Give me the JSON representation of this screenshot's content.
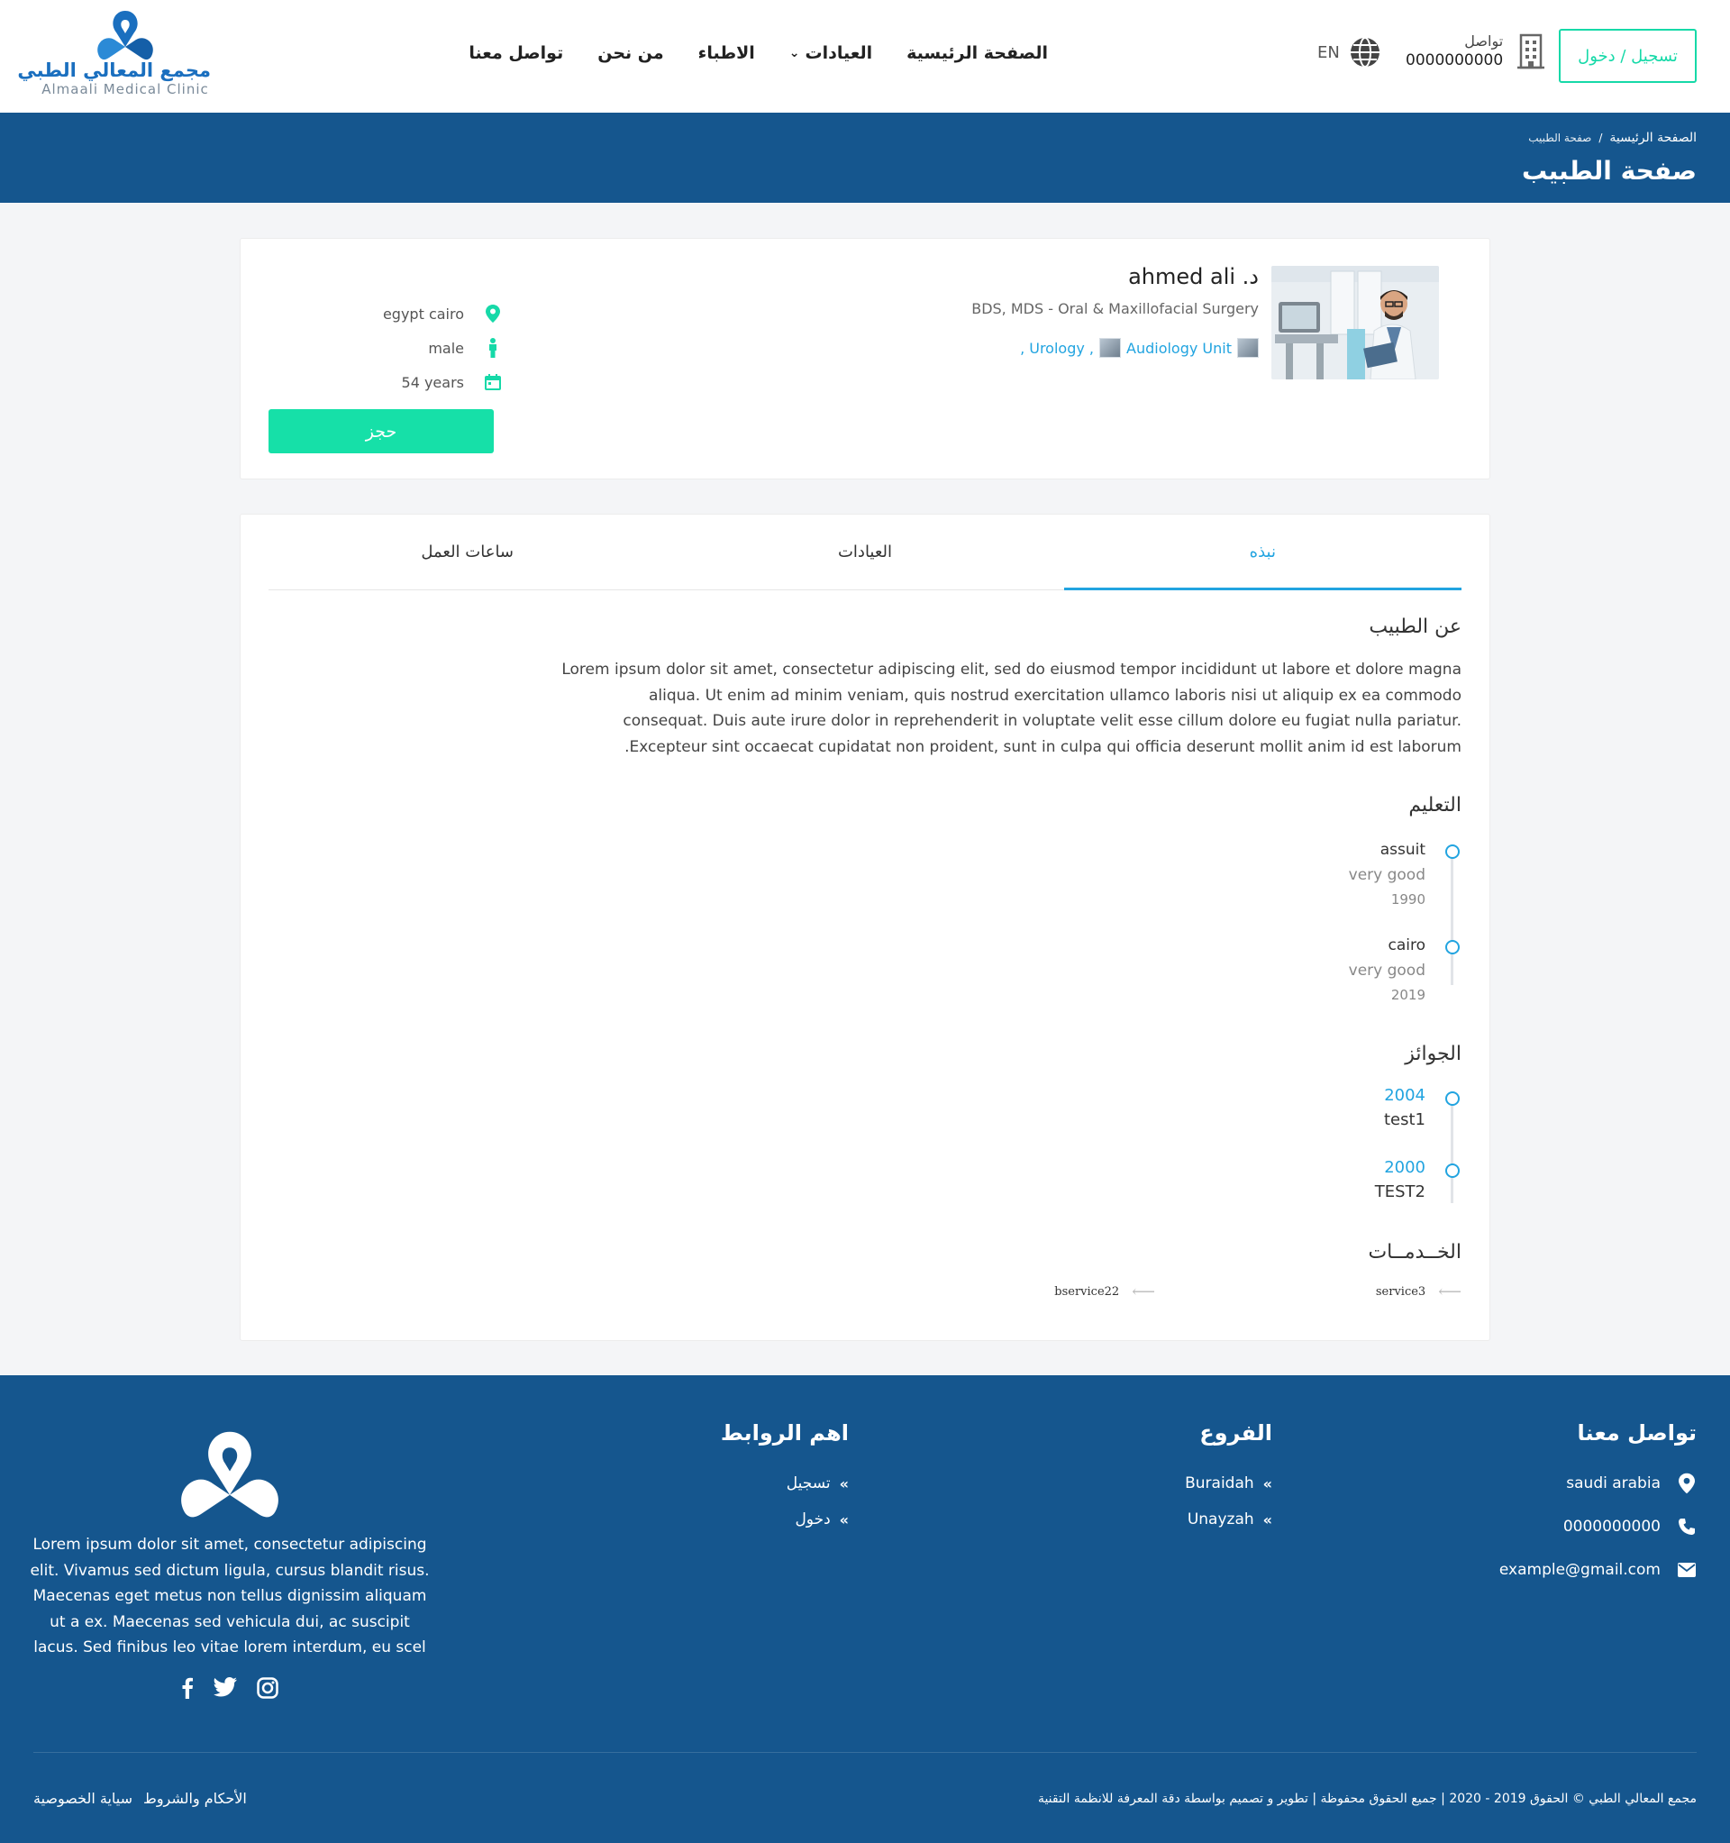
{
  "header": {
    "logo_ar": "مجمع المعالي الطبي",
    "logo_en": "Almaali Medical Clinic",
    "nav": [
      "الصفحة الرئيسية",
      "العيادات",
      "الاطباء",
      "من نحن",
      "تواصل معنا"
    ],
    "lang_code": "EN",
    "contact_label": "تواصل",
    "contact_number": "0000000000",
    "login_label": "تسجيل / دخول"
  },
  "banner": {
    "crumb_home": "الصفحة الرئيسية",
    "crumb_sep": "/",
    "crumb_current": "صفحة الطبيب",
    "title": "صفحة الطبيب"
  },
  "doctor": {
    "name": "د. ahmed ali",
    "degree": "BDS, MDS - Oral & Maxillofacial Surgery",
    "clinic_1": "Audiology Unit",
    "clinic_2": ", Urology ,",
    "location": "egypt cairo",
    "gender": "male",
    "age": "54 years",
    "book_label": "حجز"
  },
  "tabs": [
    "نبذه",
    "العيادات",
    "ساعات العمل"
  ],
  "about": {
    "title": "عن الطبيب",
    "text": "Lorem ipsum dolor sit amet, consectetur adipiscing elit, sed do eiusmod tempor incididunt ut labore et dolore magna aliqua. Ut enim ad minim veniam, quis nostrud exercitation ullamco laboris nisi ut aliquip ex ea commodo consequat. Duis aute irure dolor in reprehenderit in voluptate velit esse cillum dolore eu fugiat nulla pariatur. Excepteur sint occaecat cupidatat non proident, sunt in culpa qui officia deserunt mollit anim id est laborum."
  },
  "education": {
    "title": "التعليم",
    "items": [
      {
        "school": "assuit",
        "grade": "very good",
        "year": "1990"
      },
      {
        "school": "cairo",
        "grade": "very good",
        "year": "2019"
      }
    ]
  },
  "awards": {
    "title": "الجوائز",
    "items": [
      {
        "year": "2004",
        "title": "test1"
      },
      {
        "year": "2000",
        "title": "TEST2"
      }
    ]
  },
  "services": {
    "title": "الخــدمــات",
    "items": [
      "service3",
      "bservice22"
    ]
  },
  "footer": {
    "contact_title": "تواصل معنا",
    "address": "saudi arabia",
    "phone": "0000000000",
    "email": "example@gmail.com",
    "branches_title": "الفروع",
    "branches": [
      "Buraidah",
      "Unayzah"
    ],
    "links_title": "اهم الروابط",
    "links": [
      "تسجيل",
      "دخول"
    ],
    "description": "Lorem ipsum dolor sit amet, consectetur adipiscing elit. Vivamus sed dictum ligula, cursus blandit risus. Maecenas eget metus non tellus dignissim aliquam ut a ex. Maecenas sed vehicula dui, ac suscipit lacus. Sed finibus leo vitae lorem interdum, eu scel",
    "copyright": "مجمع المعالي الطبي © الحقوق 2019 - 2020 | جميع الحقوق محفوظة | تطوير و تصميم بواسطة دقة المعرفة للانظمة التقنية",
    "terms": "الأحكام والشروط",
    "privacy": "سياية الخصوصية"
  },
  "colors": {
    "brand_blue": "#15568e",
    "accent_green": "#16e0a8",
    "accent_cyan": "#22a4e0"
  }
}
